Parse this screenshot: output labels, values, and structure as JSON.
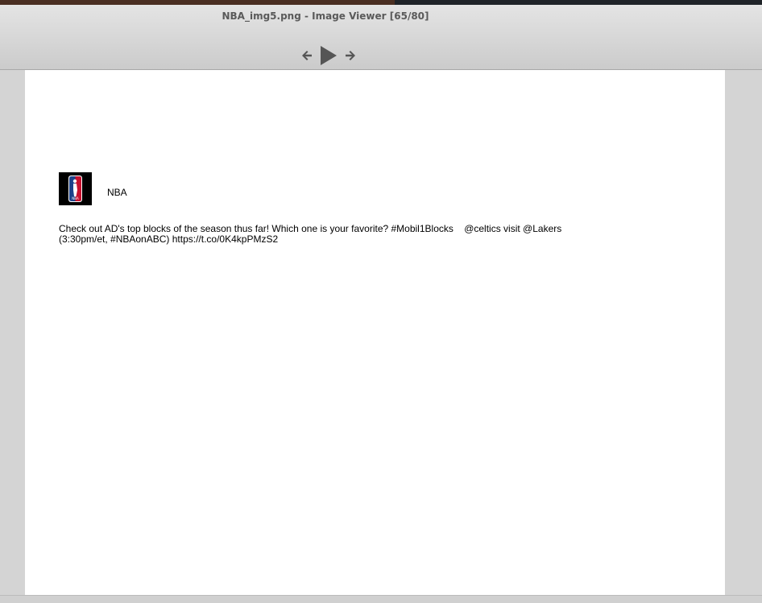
{
  "window": {
    "title": "NBA_img5.png - Image Viewer [65/80]"
  },
  "toolbar": {
    "icons": [
      "arrow-left-icon",
      "play-icon",
      "arrow-right-icon"
    ]
  },
  "tweet": {
    "username": "NBA",
    "text": "Check out AD's top blocks of the season thus far! Which one is your favorite? #Mobil1Blocks    @celtics visit @Lakers\n(3:30pm/et, #NBAonABC) https://t.co/0K4kpPMzS2"
  },
  "colors": {
    "logo_red": "#c8102e",
    "logo_blue": "#1d428a"
  }
}
